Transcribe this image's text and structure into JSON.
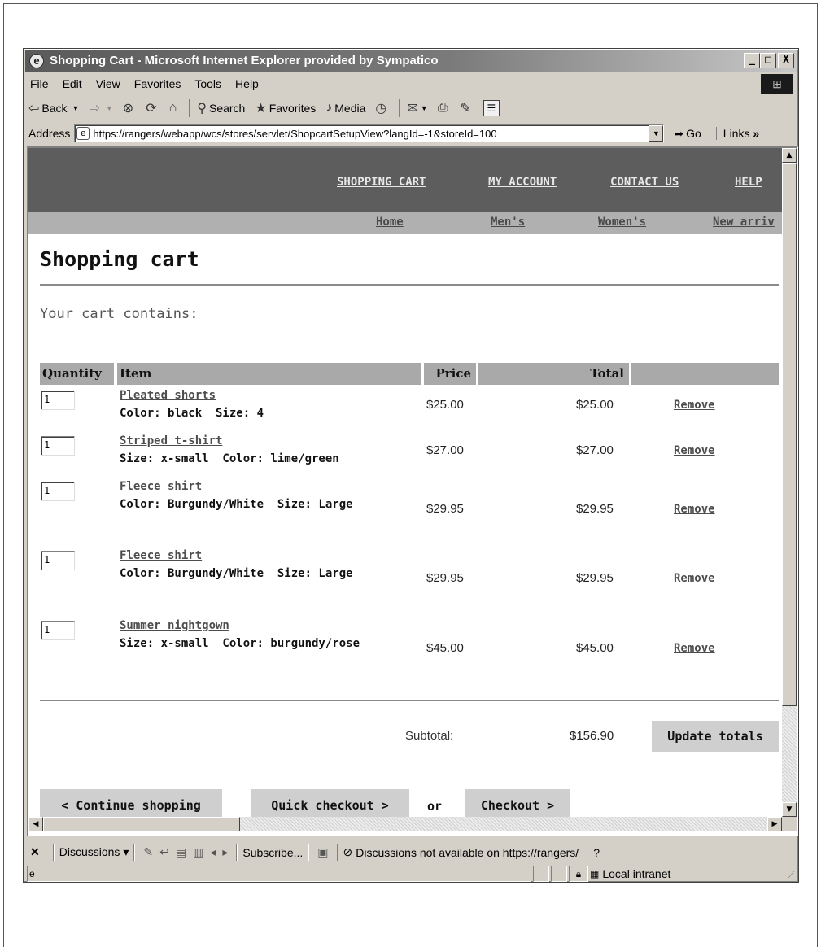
{
  "window": {
    "title": "Shopping Cart - Microsoft Internet Explorer provided by Sympatico",
    "controls": [
      "_",
      "□",
      "X"
    ]
  },
  "menu": [
    "File",
    "Edit",
    "View",
    "Favorites",
    "Tools",
    "Help"
  ],
  "toolbar": {
    "back": "Back",
    "search": "Search",
    "favorites": "Favorites",
    "media": "Media"
  },
  "address": {
    "label": "Address",
    "url": "https://rangers/webapp/wcs/stores/servlet/ShopcartSetupView?langId=-1&storeId=100",
    "go": "Go",
    "links": "Links"
  },
  "site": {
    "top_nav": [
      "SHOPPING CART",
      "MY ACCOUNT",
      "CONTACT US",
      "HELP"
    ],
    "sub_nav": [
      "Home",
      "Men's",
      "Women's",
      "New arriv"
    ]
  },
  "cart": {
    "title": "Shopping cart",
    "contains": "Your cart contains:",
    "headers": {
      "quantity": "Quantity",
      "item": "Item",
      "price": "Price",
      "total": "Total"
    },
    "items": [
      {
        "qty": "1",
        "name": "Pleated shorts",
        "details": "Color: black  Size: 4",
        "price": "$25.00",
        "total": "$25.00",
        "remove": "Remove"
      },
      {
        "qty": "1",
        "name": "Striped t-shirt",
        "details": "Size: x-small  Color: lime/green",
        "price": "$27.00",
        "total": "$27.00",
        "remove": "Remove"
      },
      {
        "qty": "1",
        "name": "Fleece shirt",
        "details": "Color: Burgundy/White  Size: Large",
        "price": "$29.95",
        "total": "$29.95",
        "remove": "Remove"
      },
      {
        "qty": "1",
        "name": "Fleece shirt",
        "details": "Color: Burgundy/White  Size: Large",
        "price": "$29.95",
        "total": "$29.95",
        "remove": "Remove"
      },
      {
        "qty": "1",
        "name": "Summer nightgown",
        "details": "Size: x-small  Color: burgundy/rose",
        "price": "$45.00",
        "total": "$45.00",
        "remove": "Remove"
      }
    ],
    "subtotal_label": "Subtotal:",
    "subtotal_value": "$156.90",
    "update_totals": "Update totals",
    "continue_shopping": "< Continue shopping",
    "quick_checkout": "Quick checkout >",
    "or": "or",
    "checkout": "Checkout >"
  },
  "discussions": {
    "label": "Discussions",
    "subscribe": "Subscribe...",
    "status": "Discussions not available on https://rangers/"
  },
  "status": {
    "zone": "Local intranet"
  }
}
